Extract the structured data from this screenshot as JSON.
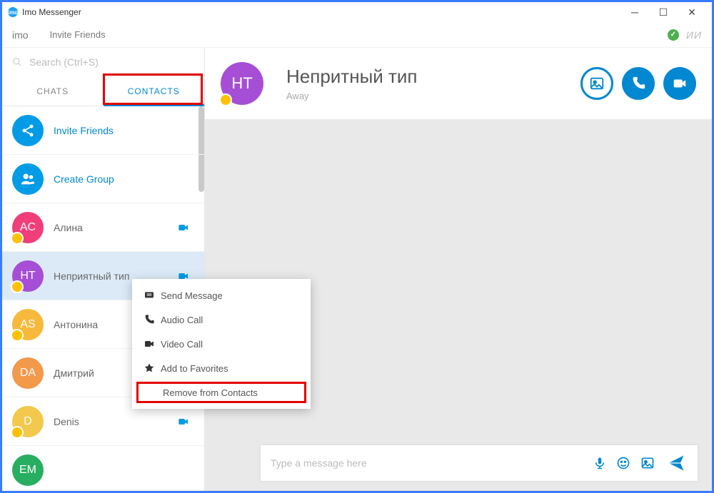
{
  "window": {
    "title": "Imo Messenger"
  },
  "toolbar": {
    "logo": "imo",
    "invite": "Invite Friends",
    "user_initials": "ИИ"
  },
  "search": {
    "placeholder": "Search (Ctrl+S)"
  },
  "tabs": {
    "chats": "CHATS",
    "contacts": "CONTACTS"
  },
  "sidebar": {
    "invite_friends": "Invite Friends",
    "create_group": "Create Group",
    "contacts": [
      {
        "initials": "AC",
        "name": "Алина",
        "color": "#ef3e7a",
        "cam": true,
        "badge": true
      },
      {
        "initials": "HT",
        "name": "Неприятный тип",
        "color": "#a64fd6",
        "cam": true,
        "badge": true,
        "selected": true
      },
      {
        "initials": "AS",
        "name": "Антонина",
        "color": "#f6b93b",
        "cam": false,
        "badge": true
      },
      {
        "initials": "DA",
        "name": "Дмитрий",
        "color": "#f2994a",
        "cam": false,
        "badge": false
      },
      {
        "initials": "D",
        "name": "Denis",
        "color": "#f2c94c",
        "cam": true,
        "badge": true
      },
      {
        "initials": "EM",
        "name": "",
        "color": "#27ae60",
        "cam": false,
        "badge": false
      }
    ]
  },
  "chat": {
    "avatar_initials": "HT",
    "avatar_color": "#a64fd6",
    "name": "Непритный тип",
    "status": "Away",
    "compose_placeholder": "Type a message here"
  },
  "context_menu": {
    "items": [
      {
        "label": "Send Message",
        "icon": "message"
      },
      {
        "label": "Audio Call",
        "icon": "phone"
      },
      {
        "label": "Video Call",
        "icon": "video"
      },
      {
        "label": "Add to Favorites",
        "icon": "star"
      },
      {
        "label": "Remove from Contacts",
        "icon": "",
        "highlight": true
      }
    ]
  }
}
